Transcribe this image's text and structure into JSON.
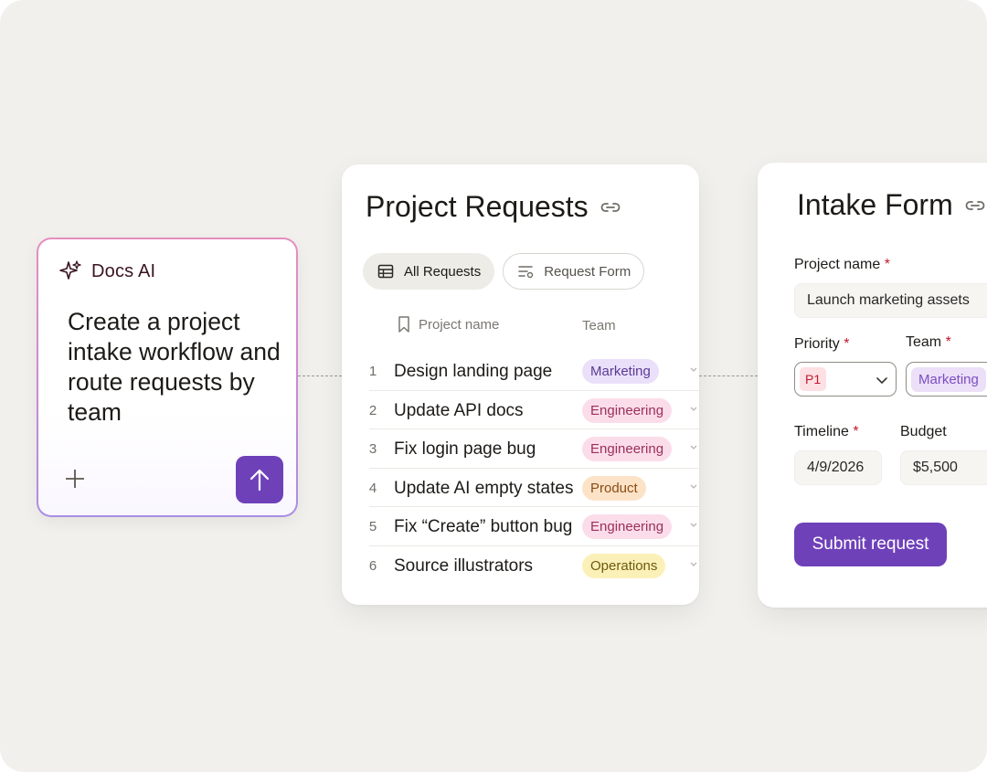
{
  "docs_ai": {
    "title": "Docs AI",
    "prompt": "Create a project intake workflow and route requests by team",
    "icons": {
      "header": "sparkle-icon",
      "add": "plus-icon",
      "send": "arrow-up-icon"
    },
    "accent_color": "#6f41b9"
  },
  "project_requests": {
    "title": "Project Requests",
    "tabs": [
      {
        "label": "All Requests",
        "icon": "table-icon",
        "active": true
      },
      {
        "label": "Request Form",
        "icon": "form-icon",
        "active": false
      }
    ],
    "columns": {
      "name": "Project name",
      "team": "Team"
    },
    "rows": [
      {
        "num": "1",
        "name": "Design landing page",
        "team": "Marketing"
      },
      {
        "num": "2",
        "name": "Update API docs",
        "team": "Engineering"
      },
      {
        "num": "3",
        "name": "Fix login page bug",
        "team": "Engineering"
      },
      {
        "num": "4",
        "name": "Update AI empty states",
        "team": "Product"
      },
      {
        "num": "5",
        "name": "Fix “Create” button bug",
        "team": "Engineering"
      },
      {
        "num": "6",
        "name": "Source illustrators",
        "team": "Operations"
      }
    ],
    "team_colors": {
      "Marketing": {
        "bg": "#ebe0fa",
        "fg": "#5b3a93"
      },
      "Engineering": {
        "bg": "#fbdde9",
        "fg": "#9b2f5a"
      },
      "Product": {
        "bg": "#fce3c8",
        "fg": "#8a4b12"
      },
      "Operations": {
        "bg": "#fbf1b8",
        "fg": "#6d5a0c"
      }
    }
  },
  "intake_form": {
    "title": "Intake Form",
    "required_mark": "*",
    "project_name_label": "Project name",
    "project_name_value": "Launch marketing assets",
    "priority_label": "Priority",
    "priority_value": "P1",
    "team_label": "Team",
    "team_value": "Marketing",
    "timeline_label": "Timeline",
    "timeline_value": "4/9/2026",
    "budget_label": "Budget",
    "budget_value": "$5,500",
    "submit_label": "Submit request"
  }
}
